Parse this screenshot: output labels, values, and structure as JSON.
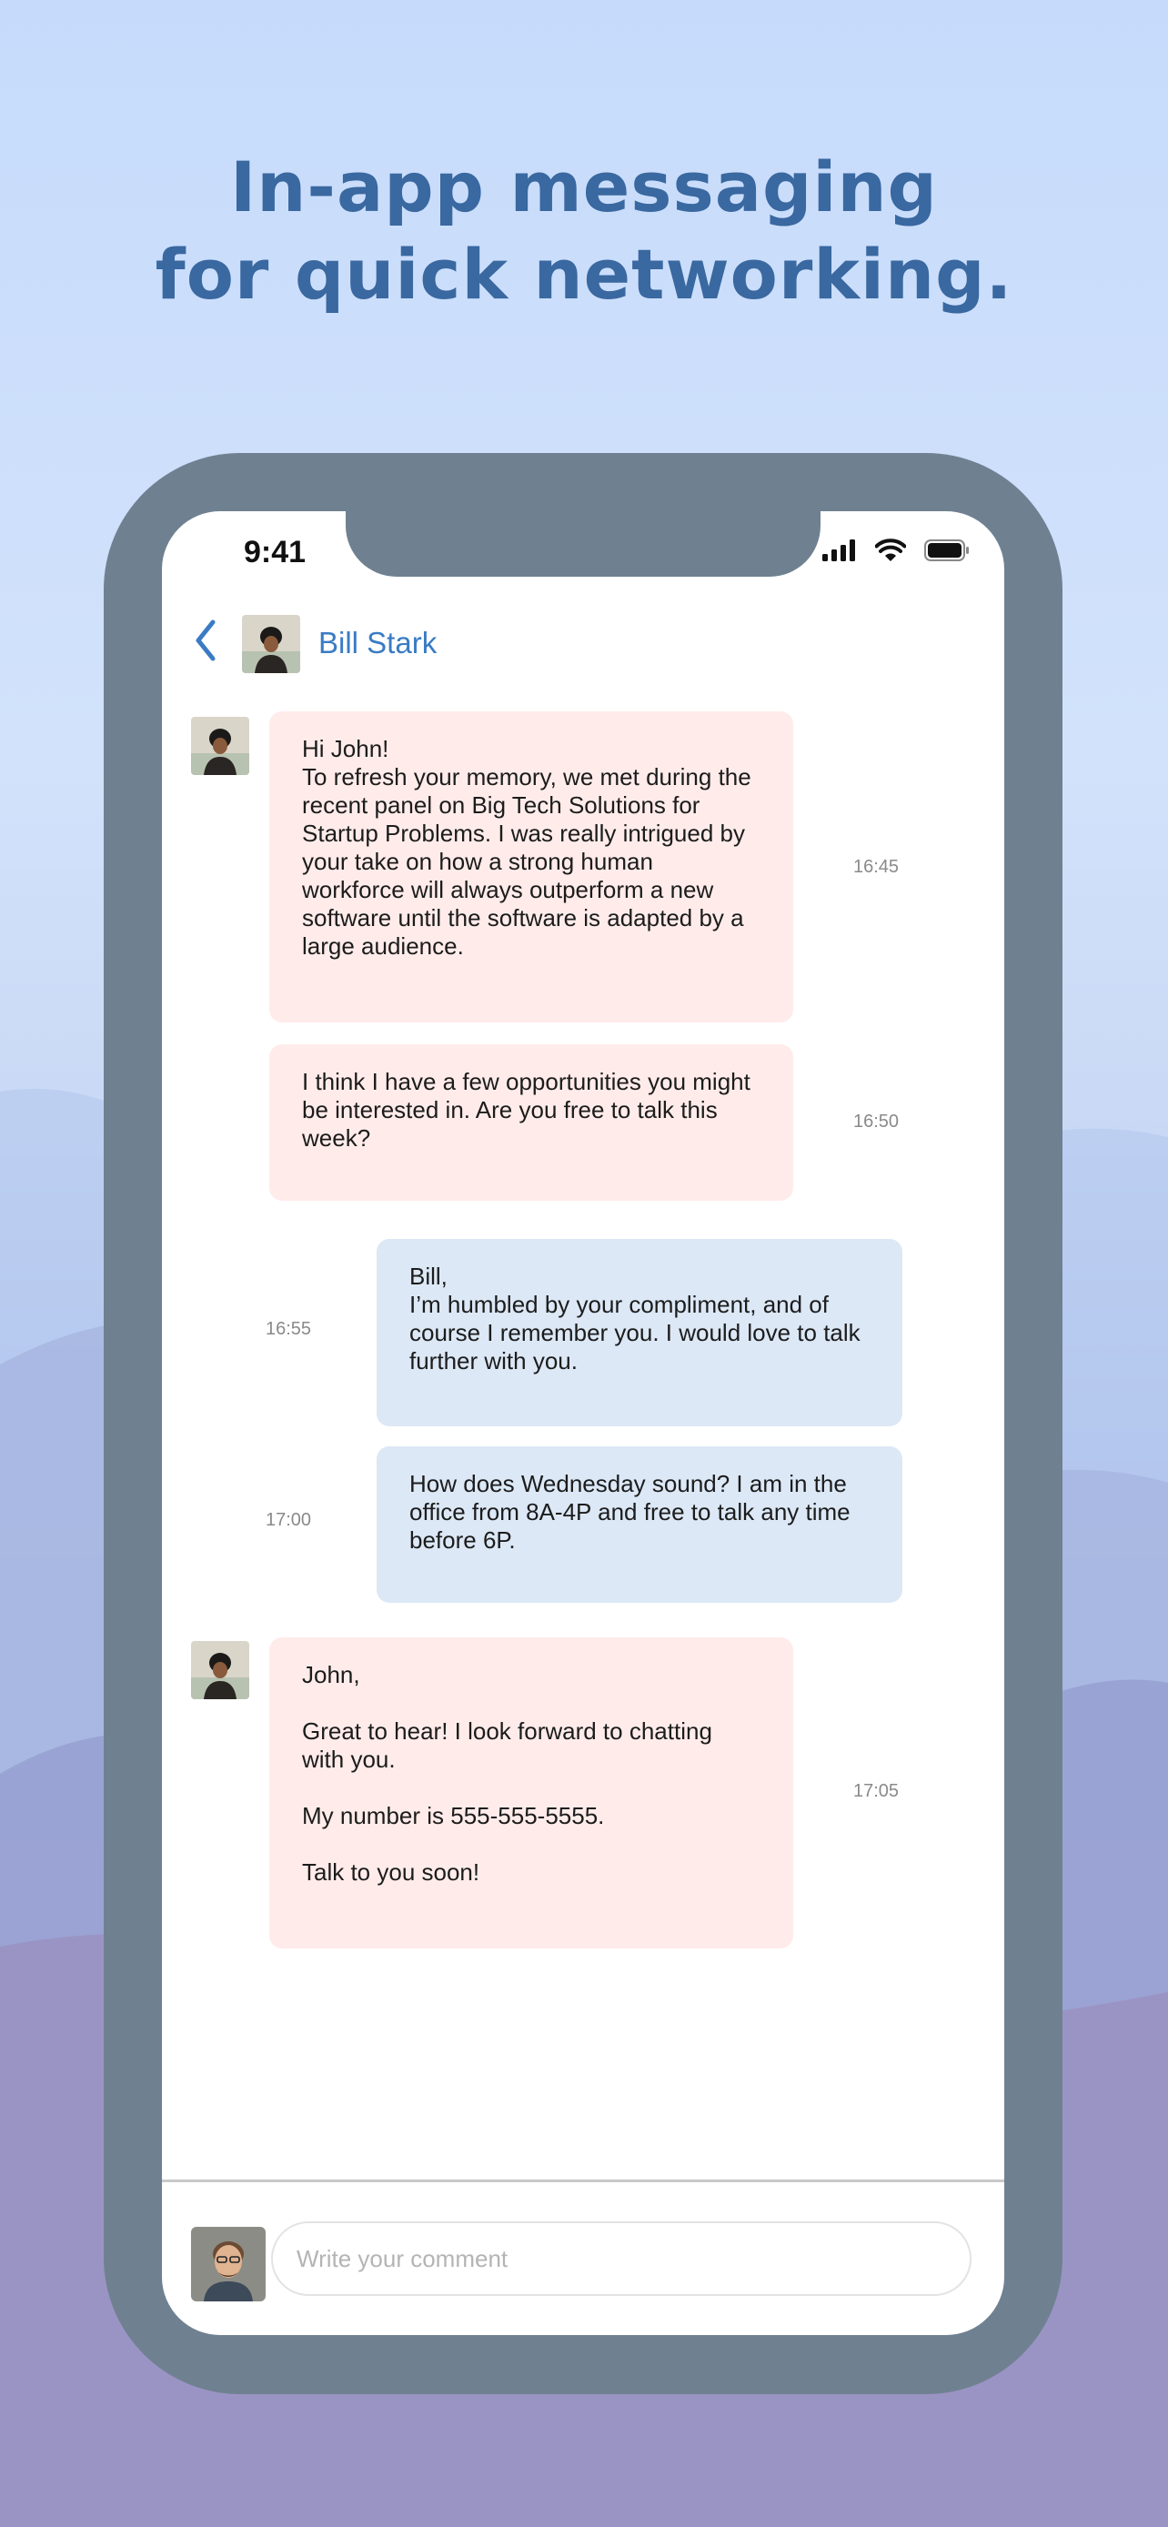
{
  "headline": {
    "line1": "In-app messaging",
    "line2": "for quick networking."
  },
  "status_bar": {
    "time": "9:41",
    "icons": [
      "cellular-signal-icon",
      "wifi-icon",
      "battery-icon"
    ]
  },
  "chat_header": {
    "back_icon": "chevron-left-icon",
    "contact_name": "Bill Stark",
    "accent_color": "#3a7bc4"
  },
  "messages": [
    {
      "direction": "incoming",
      "paragraphs": [
        "Hi John!\nTo refresh your memory, we met during the recent panel on Big Tech Solutions for Startup Problems. I was really intrigued by your take on how a strong human workforce will always outperform a new software until the software is adapted by a large audience."
      ],
      "time": "16:45"
    },
    {
      "direction": "incoming",
      "paragraphs": [
        "I think I have a few opportunities you might be interested in. Are you free to talk this week?"
      ],
      "time": "16:50"
    },
    {
      "direction": "outgoing",
      "paragraphs": [
        "Bill,\nI’m humbled by your compliment, and of course I remember you. I would love to talk further with you."
      ],
      "time": "16:55"
    },
    {
      "direction": "outgoing",
      "paragraphs": [
        "How does Wednesday sound? I am in the office from 8A-4P and free to talk any time before 6P."
      ],
      "time": "17:00"
    },
    {
      "direction": "incoming",
      "paragraphs": [
        "John,",
        "Great to hear! I look forward to chatting with you.",
        "My number is 555-555-5555.",
        "Talk to you soon!"
      ],
      "time": "17:05"
    }
  ],
  "composer": {
    "placeholder": "Write your comment",
    "value": ""
  },
  "colors": {
    "incoming_bubble": "#ffecea",
    "outgoing_bubble": "#dce8f6",
    "phone_frame": "#6f8191",
    "headline": "#3a68a0"
  }
}
